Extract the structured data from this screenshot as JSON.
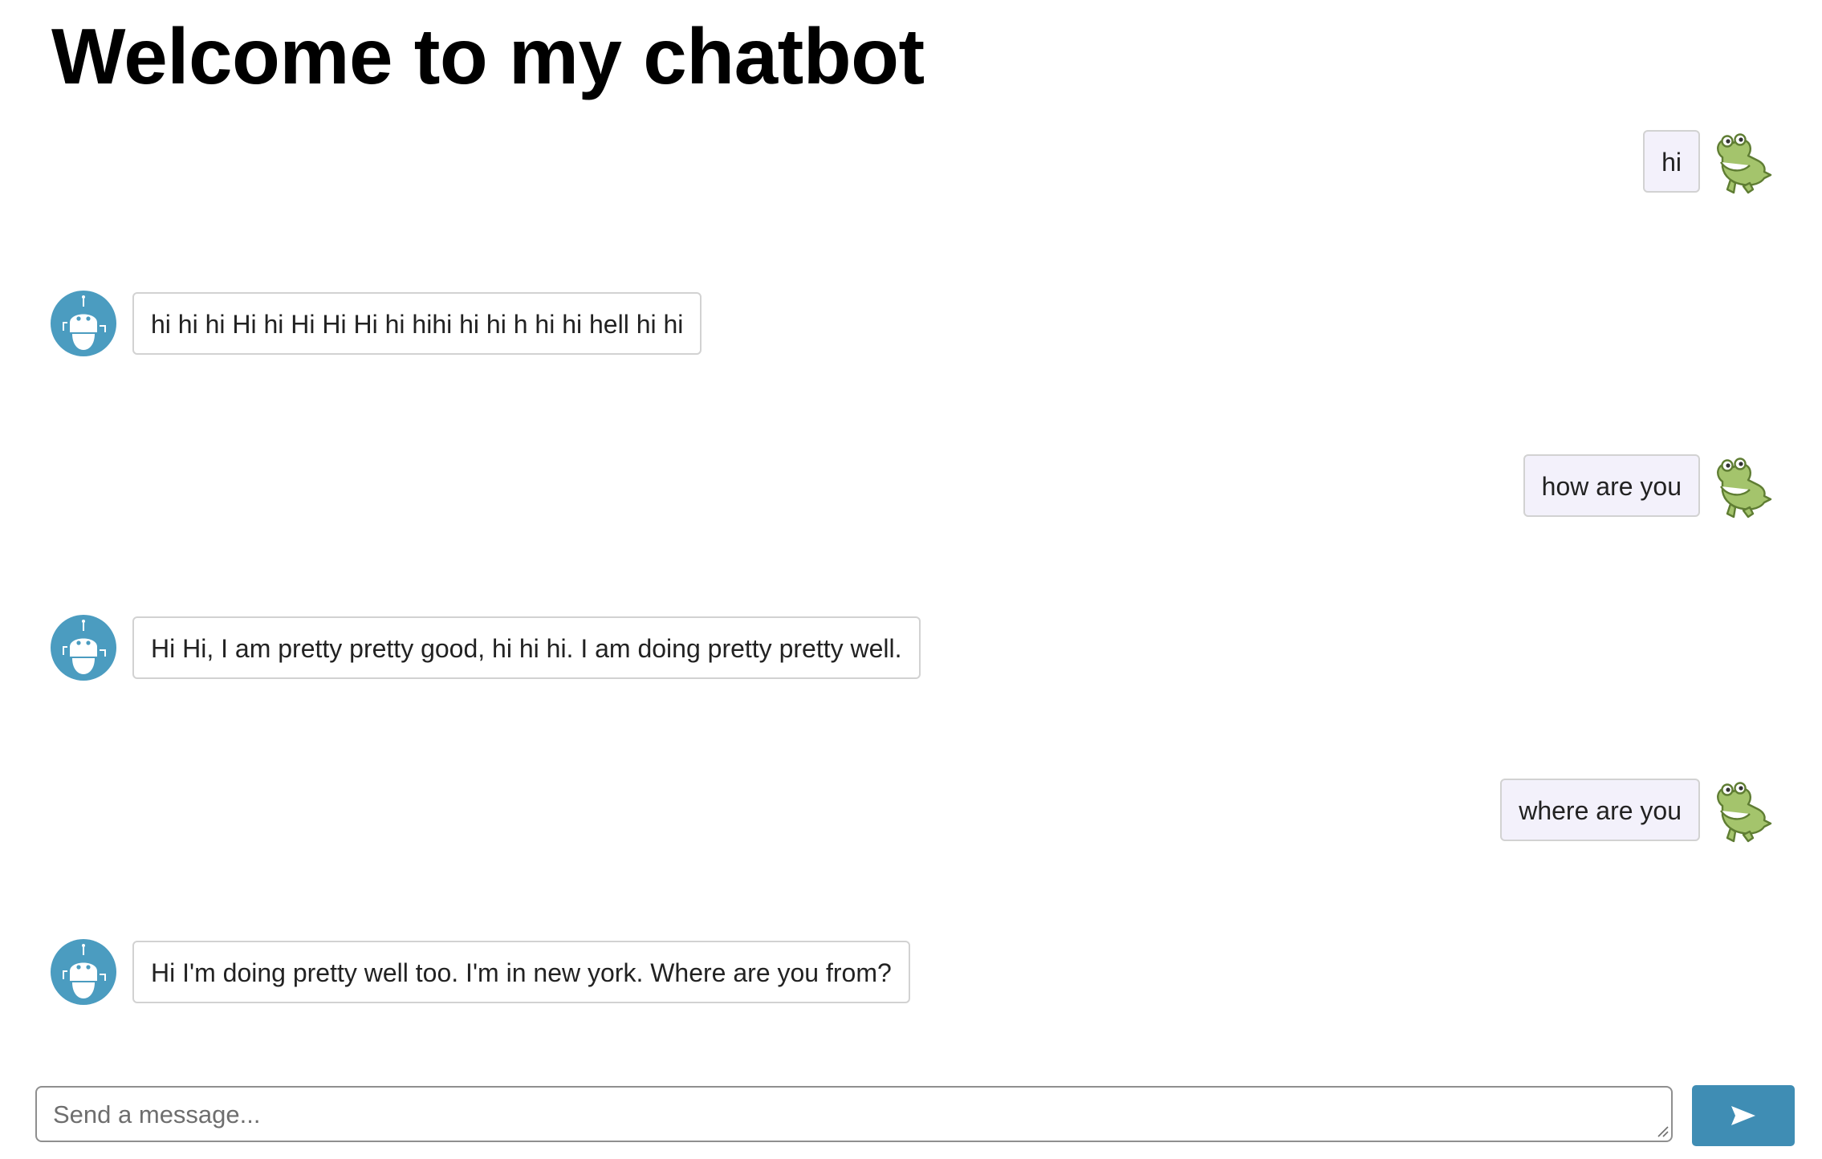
{
  "page": {
    "title": "Welcome to my chatbot"
  },
  "messages": [
    {
      "sender": "user",
      "avatar_icon": "crocodile-icon",
      "text": "hi"
    },
    {
      "sender": "bot",
      "avatar_icon": "robot-icon",
      "text": "hi hi hi Hi hi Hi Hi Hi hi hihi hi hi h hi hi hell hi hi"
    },
    {
      "sender": "user",
      "avatar_icon": "crocodile-icon",
      "text": "how are you"
    },
    {
      "sender": "bot",
      "avatar_icon": "robot-icon",
      "text": "Hi Hi, I am pretty pretty good, hi hi hi. I am doing pretty pretty well."
    },
    {
      "sender": "user",
      "avatar_icon": "crocodile-icon",
      "text": "where are you"
    },
    {
      "sender": "bot",
      "avatar_icon": "robot-icon",
      "text": "Hi I'm doing pretty well too. I'm in new york. Where are you from?"
    }
  ],
  "composer": {
    "placeholder": "Send a message...",
    "value": ""
  },
  "send_button": {
    "icon": "send-arrow-icon"
  },
  "colors": {
    "bot_avatar_bg": "#4b9cc0",
    "user_bubble_bg": "#f3f1fb",
    "bot_bubble_bg": "#ffffff",
    "send_button_bg": "#3f8db4",
    "crocodile_green": "#a4c46c"
  }
}
